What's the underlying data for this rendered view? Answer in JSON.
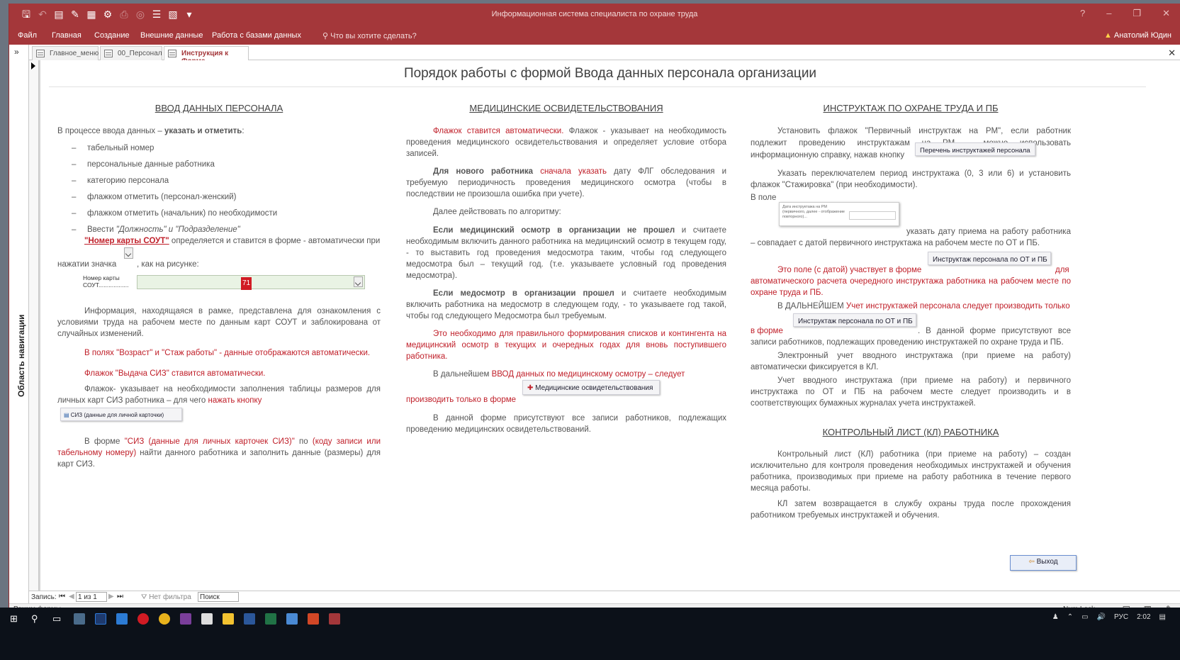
{
  "window": {
    "title": "Информационная система специалиста по охране труда"
  },
  "ribbon": {
    "tabs": [
      "Файл",
      "Главная",
      "Создание",
      "Внешние данные",
      "Работа с базами данных"
    ],
    "tell_me": "Что вы хотите сделать?",
    "user": "Анатолий Юдин"
  },
  "nav_pane": {
    "label": "Область навигации",
    "expand": "»"
  },
  "doc_tabs": [
    "Главное_меню",
    "00_Персонал",
    "Инструкция к Форме"
  ],
  "form": {
    "title": "Порядок работы с формой Ввода данных персонала организации",
    "col1": {
      "heading": "ВВОД ДАННЫХ ПЕРСОНАЛА",
      "intro_a": "В процессе ввода данных – ",
      "intro_b": "указать и отметить",
      "intro_c": ":",
      "items": [
        "табельный номер",
        "персональные данные работника",
        "категорию персонала",
        "флажком отметить (персонал-женский)",
        "флажком отметить (начальник) по необходимости"
      ],
      "item6_a": "Ввести ",
      "item6_b": "\"Должность\" и \"Подразделение\"",
      "sout_bold": "\"Номер карты СОУТ\"",
      "sout_rest": " определяется и ставится в форме - автоматически при",
      "press_a": "нажатии значка",
      "press_b": ", как на рисунке:",
      "field_label": "Номер карты СОУТ..................",
      "field_value": "71",
      "info": "Информация, находящаяся в рамке, представлена для ознакомления с условиями труда на рабочем месте по данным карт СОУТ и заблокирована от случайных изменений.",
      "age": "В полях \"Возраст\" и \"Стаж работы\" - данные отображаются автоматически.",
      "siz_flag": "Флажок \"Выдача СИЗ\" ставится автоматически.",
      "flag_a": "Флажок- указывает на необходимости заполнения таблицы размеров для личных карт СИЗ работника – для чего ",
      "flag_b": "нажать кнопку",
      "siz_button": "СИЗ (данные для личной карточки)",
      "form_a": "В форме ",
      "form_b": "\"СИЗ (данные для личных карточек СИЗ)\"",
      "form_c": " по ",
      "form_d": "(коду записи или табельному номеру)",
      "form_e": " найти данного работника и заполнить данные (размеры) для карт СИЗ."
    },
    "col2": {
      "heading": "МЕДИЦИНСКИЕ ОСВИДЕТЕЛЬСТВОВАНИЯ",
      "p1_a": "Флажок ставится автоматически.",
      "p1_b": " Флажок - указывает на необходимость проведения медицинского освидетельствования и определяет условие отбора записей.",
      "p2_a": "Для нового работника ",
      "p2_b": "сначала указать",
      "p2_c": " дату ФЛГ обследования и требуемую периодичность проведения медицинского осмотра (чтобы в последствии не произошла ошибка при учете).",
      "p3": "Далее действовать по алгоритму:",
      "p4_a": "Если медицинский осмотр в организации не прошел",
      "p4_b": " и считаете необходимым включить данного работника на медицинский осмотр в текущем году, - то выставить год проведения медосмотра таким, чтобы год следующего медосмотра был – текущий год. (т.е. указываете условный год проведения медосмотра).",
      "p5_a": "Если медосмотр в организации прошел",
      "p5_b": " и считаете необходимым включить работника на медосмотр в следующем году, - то указываете год такой, чтобы год следующего Медосмотра был требуемым.",
      "p6": "Это необходимо для правильного формирования списков и контингента на медицинский осмотр в текущих и очередных годах для вновь поступившего работника.",
      "p7_a": "В дальнейшем ",
      "p7_b": "ВВОД данных по медицинскому осмотру – следует",
      "p7_c": "производить только в форме",
      "med_button": "Медицинские освидетельствования",
      "p8": "В данной форме присутствуют все записи работников, подлежащих проведению медицинских освидетельствований."
    },
    "col3": {
      "heading": "ИНСТРУКТАЖ ПО ОХРАНЕ ТРУДА И ПБ",
      "p1": "Установить флажок \"Первичный инструктаж на РМ\", если работник подлежит проведению инструктажам на РМ, - можно использовать информационную справку, нажав кнопку",
      "list_button": "Перечень инструктажей персонала",
      "p2": "Указать переключателем период инструктажа (0, 3 или 6) и установить флажок \"Стажировка\" (при необходимости).",
      "p3": "В поле",
      "mini_label": "Дата инструктажа на РМ (первичного, далее - отображение повторного)...",
      "p4": "указать дату приема на работу работника – совпадает с датой первичного инструктажа на рабочем месте по ОТ и ПБ.",
      "instr_button": "Инструктаж персонала по ОТ и ПБ",
      "p5_a": "Это поле (с датой) участвует в форме",
      "p5_b": "для автоматического расчета очередного инструктажа работника на рабочем месте по охране труда и ПБ.",
      "p6_a": "В ДАЛЬНЕЙШЕМ ",
      "p6_b": "Учет инструктажей персонала следует производить только",
      "p7_a": "в форме",
      "p7_b": ". В данной форме присутствуют все записи работников, подлежащих проведению инструктажей по охране труда и ПБ.",
      "p8": "Электронный учет вводного инструктажа (при приеме на работу) автоматически фиксируется в КЛ.",
      "p9": "Учет вводного инструктажа (при приеме на работу) и первичного инструктажа по ОТ и ПБ на рабочем месте следует производить и в соответствующих бумажных журналах учета инструктажей.",
      "heading2": "КОНТРОЛЬНЫЙ ЛИСТ (КЛ) РАБОТНИКА",
      "p10": "Контрольный лист (КЛ) работника (при приеме на работу) – создан исключительно для контроля проведения необходимых инструктажей и обучения работника, производимых при приеме на работу работника в течение первого месяца работы.",
      "p11": "КЛ затем возвращается в службу охраны труда после прохождения работником требуемых инструктажей и обучения."
    },
    "exit_button": "Выход"
  },
  "record_nav": {
    "label": "Запись:",
    "position": "1 из 1",
    "filter": "Нет фильтра",
    "search": "Поиск"
  },
  "status": {
    "mode": "Режим формы",
    "numlock": "Num Lock"
  },
  "tray": {
    "lang": "РУС",
    "time": "2:02"
  },
  "colors": {
    "accent": "#a4373a",
    "red_text": "#c0202a"
  }
}
